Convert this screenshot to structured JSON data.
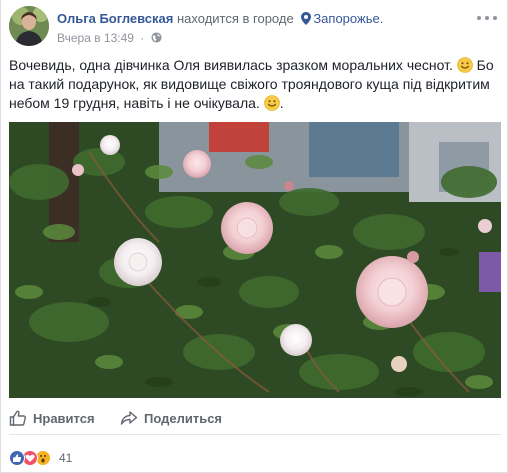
{
  "post": {
    "author": {
      "name": "Ольга Боглевская",
      "status": "находится в городе",
      "location": "Запорожье."
    },
    "meta": {
      "timestamp": "Вчера в 13:49",
      "separator": "·",
      "privacy_icon": "globe-icon"
    },
    "text_parts": [
      "Вочевидь, одна дівчинка Оля виявилась зразком моральних чеснот.",
      "Бо на такий подарунок, як видовище свіжого трояндового куща під відкритим небом 19 грудня, навіть і не очікувала.",
      "."
    ],
    "photo": {
      "subject": "pink-rose-bush"
    }
  },
  "actions": {
    "like_label": "Нравится",
    "share_label": "Поделиться"
  },
  "reactions": {
    "types": [
      "like",
      "love",
      "wow"
    ],
    "count": "41"
  },
  "colors": {
    "link": "#365899",
    "secondary_text": "#616770",
    "meta_text": "#90949c",
    "like_blue": "#4267b2",
    "love_red": "#f25268",
    "wow_yellow": "#f7b125"
  }
}
